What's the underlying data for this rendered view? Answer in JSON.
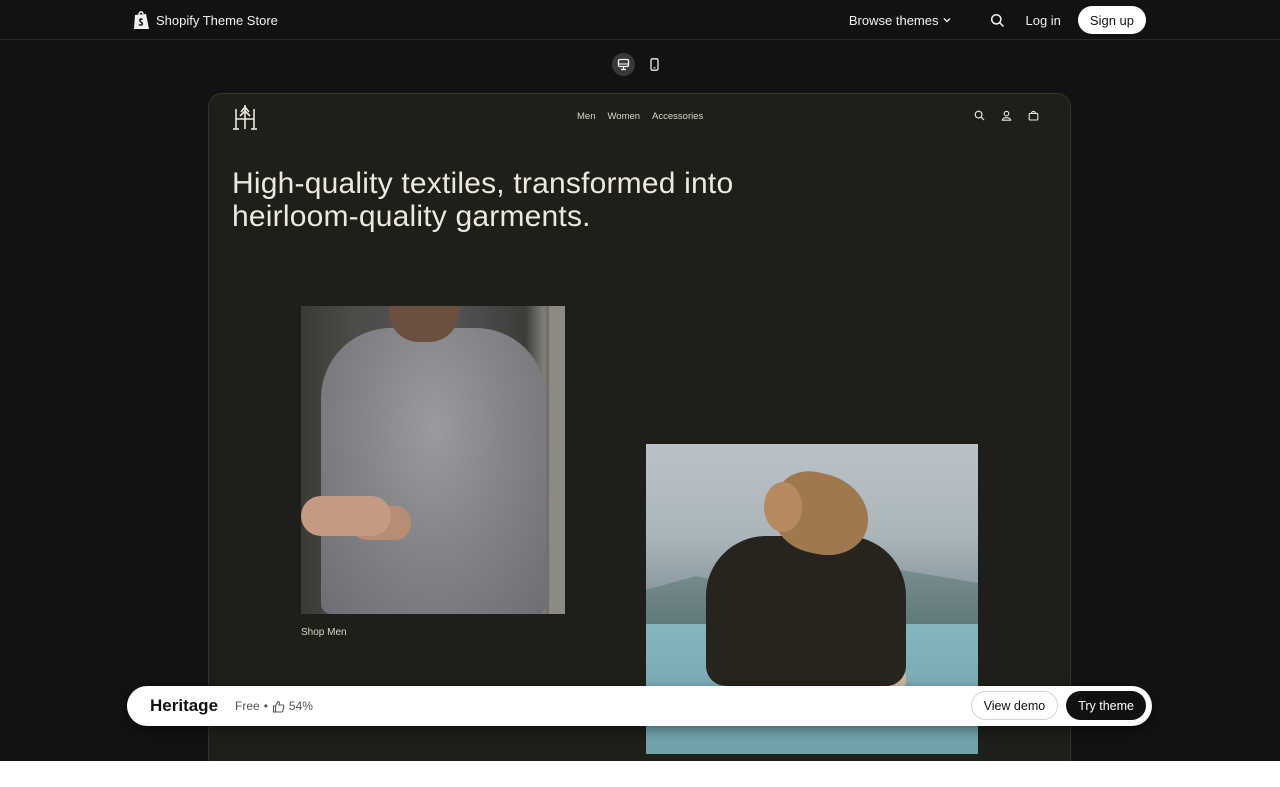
{
  "topnav": {
    "brand_label": "Shopify Theme Store",
    "brand_icon": "shopify-bag-icon",
    "browse_label": "Browse themes",
    "login_label": "Log in",
    "signup_label": "Sign up"
  },
  "device_toggle": {
    "options": [
      "desktop",
      "mobile"
    ],
    "selected": "desktop"
  },
  "preview": {
    "menu": [
      "Men",
      "Women",
      "Accessories"
    ],
    "icons": [
      "search-icon",
      "account-icon",
      "cart-icon"
    ],
    "heading": "High-quality textiles, transformed into heirloom-quality garments.",
    "caption_men": "Shop Men"
  },
  "theme_bar": {
    "name": "Heritage",
    "price": "Free",
    "separator": "•",
    "rating": "54%",
    "view_demo_label": "View demo",
    "try_theme_label": "Try theme"
  },
  "colors": {
    "app_bg": "#131112",
    "preview_bg": "#1f1f19",
    "heading_text": "#ece9dc",
    "primary_button": "#111111"
  }
}
